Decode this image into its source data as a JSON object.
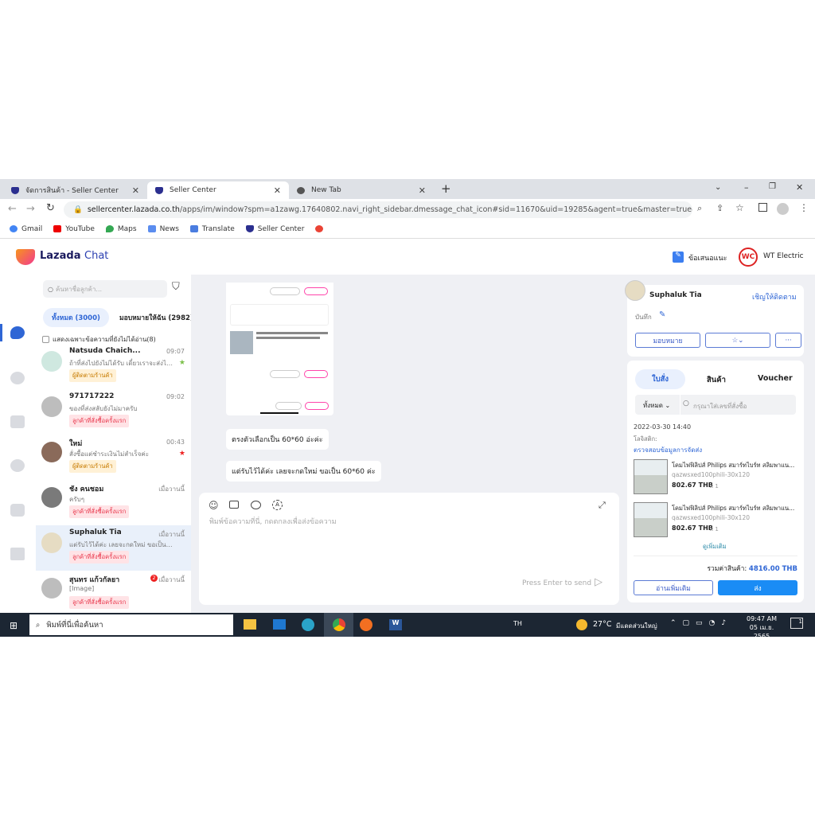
{
  "browser": {
    "tabs": [
      {
        "label": "จัดการสินค้า - Seller Center",
        "active": false
      },
      {
        "label": "Seller Center",
        "active": true
      },
      {
        "label": "New Tab",
        "active": false
      }
    ],
    "url_host": "sellercenter.lazada.co.th",
    "url_path": "/apps/im/window?spm=a1zawg.17640802.navi_right_sidebar.dmessage_chat_icon#sid=11670&uid=19285&agent=true&master=true&ena...",
    "bookmarks": [
      "Gmail",
      "YouTube",
      "Maps",
      "News",
      "Translate",
      "Seller Center"
    ]
  },
  "app": {
    "logo_a": "Lazada",
    "logo_b": "Chat",
    "feedback": "ข้อเสนอแนะ",
    "shop_badge": "WC",
    "shop_name": "WT Electric",
    "accent": "#2f66d5"
  },
  "list": {
    "search_placeholder": "ค้นหาชื่อลูกค้า...",
    "tab_all": "ทั้งหมด (3000)",
    "tab_assigned": "มอบหมายให้ฉัน (2982)",
    "unread_only": "แสดงเฉพาะข้อความที่ยังไม่ได้อ่าน(8)",
    "conversations": [
      {
        "name": "Natsuda Chaich...",
        "time": "09:07",
        "msg": "ถ้าที่ส่งไปยังไม่ได้รับ เดี๋ยวเราจะส่งไป...",
        "tag": "ผู้ติดตามร้านค้า",
        "star": "green"
      },
      {
        "name": "971717222",
        "time": "09:02",
        "msg": "ของที่ส่งสลับยังไม่มาครับ",
        "tag": "ลูกค้าที่สั่งซื้อครั้งแรก"
      },
      {
        "name": "ใหม่",
        "time": "00:43",
        "msg": "สั่งซื้อแต่ชำระเงินไม่สำเร็จค่ะ",
        "tag": "ผู้ติดตามร้านค้า",
        "star": "red"
      },
      {
        "name": "ชัง คนชอม",
        "time": "เมื่อวานนี้",
        "msg": "ครับๆ",
        "tag": "ลูกค้าที่สั่งซื้อครั้งแรก"
      },
      {
        "name": "Suphaluk Tia",
        "time": "เมื่อวานนี้",
        "msg": "แต่รับไว้ได้ค่ะ เลยจะกดใหม่ ขอเป็น 60*60...",
        "tag": "ลูกค้าที่สั่งซื้อครั้งแรก",
        "selected": true
      },
      {
        "name": "สุนทร แก้วกัลยา",
        "time": "เมื่อวานนี้",
        "msg": "[Image]",
        "tag": "ลูกค้าที่สั่งซื้อครั้งแรก",
        "unread": "2"
      }
    ]
  },
  "chat": {
    "messages": [
      "ตรงตัวเลือกเป็น 60*60 อ่ะค่ะ",
      "แต่รับไว้ได้ค่ะ เลยจะกดใหม่ ขอเป็น 60*60 ค่ะ"
    ],
    "input_placeholder": "พิมพ์ข้อความที่นี่, กดตกลงเพื่อส่งข้อความ",
    "send_hint": "Press Enter to send"
  },
  "customer": {
    "name": "Suphaluk Tia",
    "follow": "เชิญให้ติดตาม",
    "note": "บันทึก",
    "assign": "มอบหมาย",
    "more": "···"
  },
  "orders": {
    "tabs": [
      "ใบสั่ง",
      "สินค้า",
      "Voucher"
    ],
    "filter": "ทั้งหมด",
    "search_placeholder": "กรุณาใส่เลขที่สั่งซื้อ",
    "date": "2022-03-30 14:40",
    "logistics_label": "โลจิสติก:",
    "check_shipping": "ตรวจสอบข้อมูลการจัดส่ง",
    "items": [
      {
        "title": "โคมไฟฟิลิปส์ Philips สมาร์ทไบร์ท สลิมพาแน...",
        "sku": "qazwsxed100phili-30x120",
        "price": "802.67 THB",
        "qty": "x 1"
      },
      {
        "title": "โคมไฟฟิลิปส์ Philips สมาร์ทไบร์ท สลิมพาแน...",
        "sku": "qazwsxed100phili-30x120",
        "price": "802.67 THB",
        "qty": "x 1"
      }
    ],
    "see_more": "ดูเพิ่มเติม",
    "total_label": "รวมค่าสินค้า:",
    "total": "4816.00 THB",
    "read_more": "อ่านเพิ่มเติม",
    "send": "ส่ง"
  },
  "taskbar": {
    "search": "พิมพ์ที่นี่เพื่อค้นหา",
    "lang": "TH",
    "weather": "27°C",
    "weather_desc": "มีแดดส่วนใหญ่",
    "time": "09:47 AM",
    "date": "05 เม.ย. 2565",
    "notifications": "1"
  }
}
